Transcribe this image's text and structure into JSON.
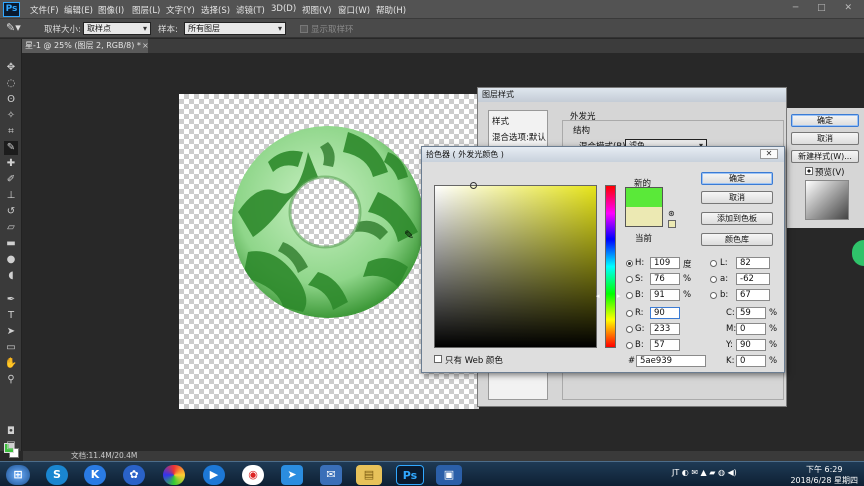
{
  "app": {
    "logo": "Ps",
    "menus": [
      "文件(F)",
      "编辑(E)",
      "图像(I)",
      "图层(L)",
      "文字(Y)",
      "选择(S)",
      "滤镜(T)",
      "3D(D)",
      "视图(V)",
      "窗口(W)",
      "帮助(H)"
    ],
    "window_controls": "─ □ ✕"
  },
  "options": {
    "sample_size_label": "取样大小:",
    "sample_size_value": "取样点",
    "sample_label": "样本:",
    "sample_value": "所有图层",
    "show_ring_label": "显示取样环"
  },
  "document": {
    "tab": "星-1 @ 25% (图层 2, RGB/8) *",
    "status": "文档:11.4M/20.4M"
  },
  "layer_style": {
    "title": "图层样式",
    "styles_header": "样式",
    "blend_options": "混合选项:默认",
    "section": "外发光",
    "structure": "结构",
    "blend_mode_label": "混合模式(B):",
    "blend_mode_value": "滤色",
    "ok": "确定",
    "cancel": "取消",
    "new_style": "新建样式(W)...",
    "preview": "预览(V)"
  },
  "color_picker": {
    "title": "拾色器 ( 外发光颜色 )",
    "new_label": "新的",
    "current_label": "当前",
    "ok": "确定",
    "cancel": "取消",
    "add_swatch": "添加到色板",
    "color_library": "颜色库",
    "web_only": "只有 Web 颜色",
    "new_color": "#5ae939",
    "current_color": "#ece9b3",
    "hsb": [
      {
        "key": "H:",
        "value": "109",
        "unit": "度",
        "checked": true
      },
      {
        "key": "S:",
        "value": "76",
        "unit": "%",
        "checked": false
      },
      {
        "key": "B:",
        "value": "91",
        "unit": "%",
        "checked": false
      }
    ],
    "rgb": [
      {
        "key": "R:",
        "value": "90",
        "checked": false
      },
      {
        "key": "G:",
        "value": "233",
        "checked": false
      },
      {
        "key": "B:",
        "value": "57",
        "checked": false
      }
    ],
    "lab": [
      {
        "key": "L:",
        "value": "82"
      },
      {
        "key": "a:",
        "value": "-62"
      },
      {
        "key": "b:",
        "value": "67"
      }
    ],
    "cmyk": [
      {
        "key": "C:",
        "value": "59",
        "unit": "%"
      },
      {
        "key": "M:",
        "value": "0",
        "unit": "%"
      },
      {
        "key": "Y:",
        "value": "90",
        "unit": "%"
      },
      {
        "key": "K:",
        "value": "0",
        "unit": "%"
      }
    ],
    "hex_label": "#",
    "hex": "5ae939"
  },
  "taskbar": {
    "time": "下午 6:29",
    "date": "2018/6/28 星期四"
  }
}
